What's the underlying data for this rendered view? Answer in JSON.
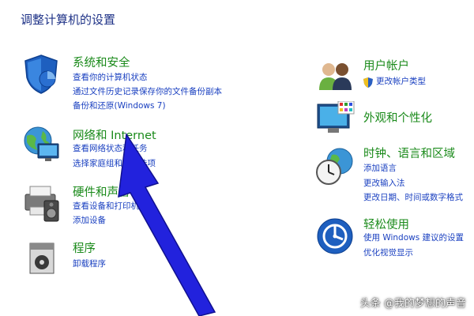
{
  "page_title": "调整计算机的设置",
  "left": {
    "system": {
      "title": "系统和安全",
      "links": [
        "查看你的计算机状态",
        "通过文件历史记录保存你的文件备份副本",
        "备份和还原(Windows 7)"
      ]
    },
    "network": {
      "title": "网络和 Internet",
      "links": [
        "查看网络状态和任务",
        "选择家庭组和共享选项"
      ]
    },
    "hardware": {
      "title": "硬件和声音",
      "links": [
        "查看设备和打印机",
        "添加设备"
      ]
    },
    "programs": {
      "title": "程序",
      "links": [
        "卸载程序"
      ]
    }
  },
  "right": {
    "user": {
      "title": "用户帐户",
      "links": [
        "更改帐户类型"
      ]
    },
    "appearance": {
      "title": "外观和个性化",
      "links": []
    },
    "clock": {
      "title": "时钟、语言和区域",
      "links": [
        "添加语言",
        "更改输入法",
        "更改日期、时间或数字格式"
      ]
    },
    "ease": {
      "title": "轻松使用",
      "links": [
        "使用 Windows 建议的设置",
        "优化视觉显示"
      ]
    }
  },
  "watermark": "头条 @我的梦想的声音",
  "colors": {
    "title": "#1e3287",
    "category": "#1a8a1a",
    "link": "#1a40c0",
    "arrow": "#2222dd"
  }
}
